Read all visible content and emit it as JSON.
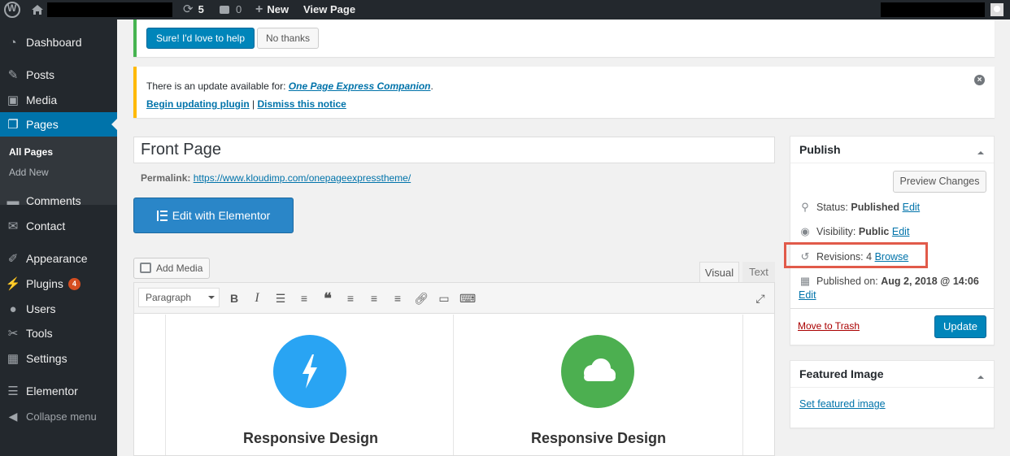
{
  "admin_bar": {
    "updates_count": "5",
    "comments_count": "0",
    "new_label": "New",
    "view_page_label": "View Page"
  },
  "sidebar": {
    "items": [
      {
        "label": "Dashboard",
        "icon": "dashboard-icon"
      },
      {
        "label": "Posts",
        "icon": "pin-icon"
      },
      {
        "label": "Media",
        "icon": "media-icon"
      },
      {
        "label": "Pages",
        "icon": "pages-icon"
      },
      {
        "label": "Comments",
        "icon": "comment-icon"
      },
      {
        "label": "Contact",
        "icon": "mail-icon"
      },
      {
        "label": "Appearance",
        "icon": "brush-icon"
      },
      {
        "label": "Plugins",
        "icon": "plug-icon",
        "badge": "4"
      },
      {
        "label": "Users",
        "icon": "user-icon"
      },
      {
        "label": "Tools",
        "icon": "wrench-icon"
      },
      {
        "label": "Settings",
        "icon": "settings-icon"
      },
      {
        "label": "Elementor",
        "icon": "elementor-icon"
      },
      {
        "label": "Collapse menu",
        "icon": "collapse-icon"
      }
    ],
    "submenu": [
      "All Pages",
      "Add New"
    ]
  },
  "notice1": {
    "yes_label": "Sure! I'd love to help",
    "no_label": "No thanks"
  },
  "notice2": {
    "text": "There is an update available for: ",
    "plugin": "One Page Express Companion",
    "period": ".",
    "begin_link": "Begin updating plugin",
    "separator": " | ",
    "dismiss_link": "Dismiss this notice"
  },
  "editor": {
    "title": "Front Page",
    "permalink_label": "Permalink:",
    "permalink_url": "https://www.kloudimp.com/onepageexpresstheme/",
    "elementor_label": "Edit with Elementor",
    "add_media_label": "Add Media",
    "tab_visual": "Visual",
    "tab_text": "Text",
    "format_select": "Paragraph",
    "features": [
      {
        "title": "Responsive Design",
        "color": "#29a4f3",
        "icon": "lightning-icon"
      },
      {
        "title": "Responsive Design",
        "color": "#4caf50",
        "icon": "cloud-icon"
      }
    ]
  },
  "publish": {
    "header": "Publish",
    "preview_label": "Preview Changes",
    "status_label": "Status: ",
    "status_value": "Published",
    "visibility_label": "Visibility: ",
    "visibility_value": "Public",
    "revisions_label": "Revisions: ",
    "revisions_value": "4",
    "browse_label": "Browse",
    "published_label": "Published on: ",
    "published_value": "Aug 2, 2018 @ 14:06",
    "edit_label": "Edit",
    "trash_label": "Move to Trash",
    "update_label": "Update"
  },
  "featured_image": {
    "header": "Featured Image",
    "link": "Set featured image"
  },
  "colors": {
    "admin_bg": "#23282d",
    "accent": "#0073aa",
    "highlight": "#e15a4a"
  }
}
